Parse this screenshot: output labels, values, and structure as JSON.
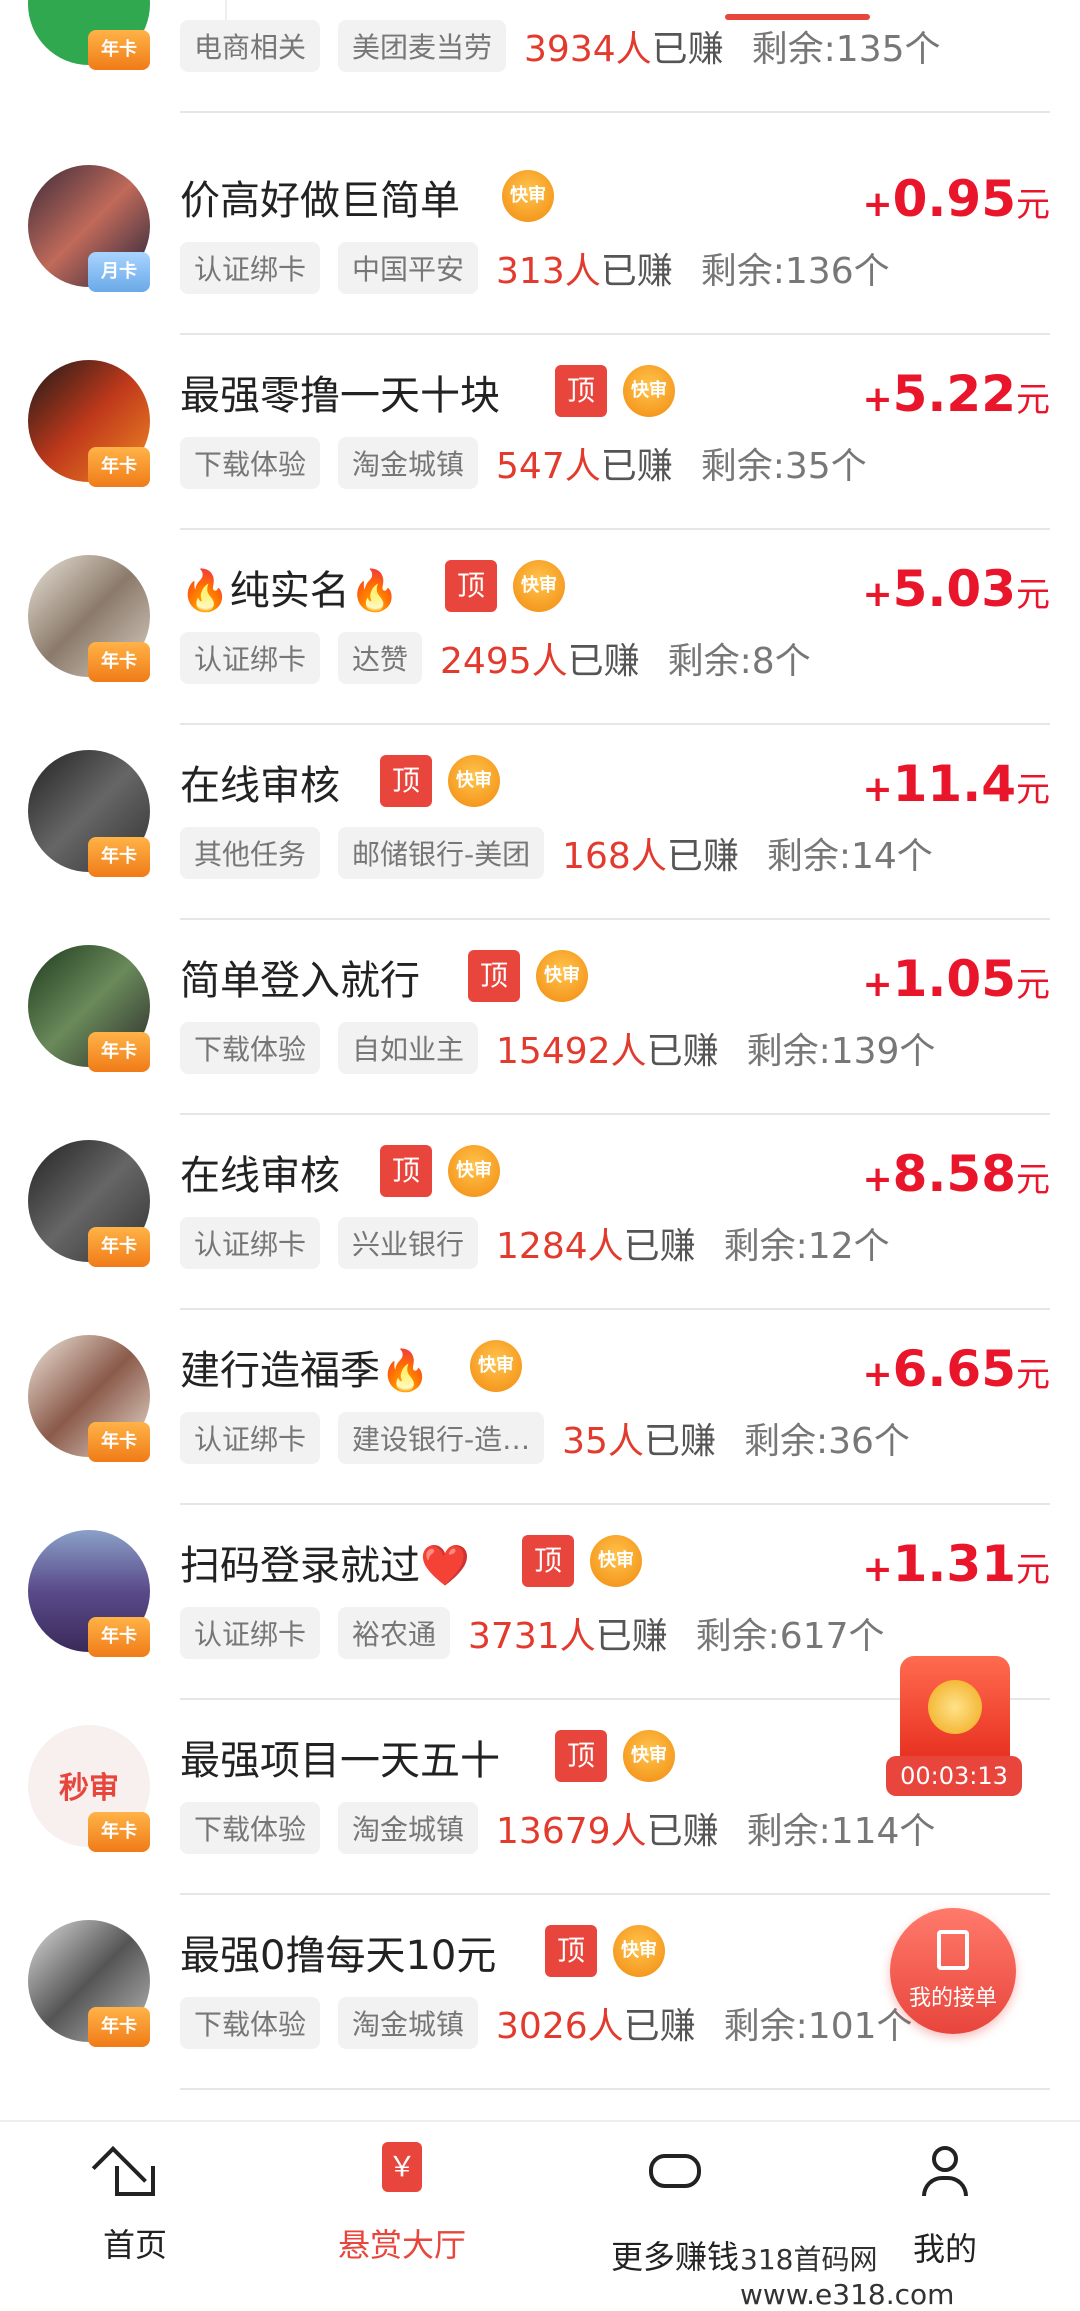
{
  "tasks": [
    {
      "title": "",
      "tag1": "电商相关",
      "tag2": "美团麦当劳",
      "earned": "3934人",
      "earned_suffix": "已赚",
      "remain": "剩余:135个",
      "reward": "",
      "badge": "年卡"
    },
    {
      "title": "价高好做巨简单",
      "tag1": "认证绑卡",
      "tag2": "中国平安",
      "earned": "313人",
      "earned_suffix": "已赚",
      "remain": "剩余:136个",
      "reward": "0.95",
      "badge": "月卡"
    },
    {
      "title": "最强零撸一天十块",
      "tag1": "下载体验",
      "tag2": "淘金城镇",
      "earned": "547人",
      "earned_suffix": "已赚",
      "remain": "剩余:35个",
      "reward": "5.22",
      "badge": "年卡"
    },
    {
      "title": "🔥纯实名🔥",
      "tag1": "认证绑卡",
      "tag2": "达赞",
      "earned": "2495人",
      "earned_suffix": "已赚",
      "remain": "剩余:8个",
      "reward": "5.03",
      "badge": "年卡"
    },
    {
      "title": "在线审核",
      "tag1": "其他任务",
      "tag2": "邮储银行-美团",
      "earned": "168人",
      "earned_suffix": "已赚",
      "remain": "剩余:14个",
      "reward": "11.4",
      "badge": "年卡"
    },
    {
      "title": "简单登入就行",
      "tag1": "下载体验",
      "tag2": "自如业主",
      "earned": "15492人",
      "earned_suffix": "已赚",
      "remain": "剩余:139个",
      "reward": "1.05",
      "badge": "年卡"
    },
    {
      "title": "在线审核",
      "tag1": "认证绑卡",
      "tag2": "兴业银行",
      "earned": "1284人",
      "earned_suffix": "已赚",
      "remain": "剩余:12个",
      "reward": "8.58",
      "badge": "年卡"
    },
    {
      "title": "建行造福季🔥",
      "tag1": "认证绑卡",
      "tag2": "建设银行-造…",
      "earned": "35人",
      "earned_suffix": "已赚",
      "remain": "剩余:36个",
      "reward": "6.65",
      "badge": "年卡"
    },
    {
      "title": "扫码登录就过❤️",
      "tag1": "认证绑卡",
      "tag2": "裕农通",
      "earned": "3731人",
      "earned_suffix": "已赚",
      "remain": "剩余:617个",
      "reward": "1.31",
      "badge": "年卡"
    },
    {
      "title": "最强项目一天五十",
      "tag1": "下载体验",
      "tag2": "淘金城镇",
      "earned": "13679人",
      "earned_suffix": "已赚",
      "remain": "剩余:114个",
      "reward": "",
      "badge": "年卡",
      "avatar_text": "秒审"
    },
    {
      "title": "最强0撸每天10元",
      "tag1": "下载体验",
      "tag2": "淘金城镇",
      "earned": "3026人",
      "earned_suffix": "已赚",
      "remain": "剩余:101个",
      "reward": "",
      "badge": "年卡"
    }
  ],
  "labels": {
    "top_flag": "顶",
    "fast_flag": "快审",
    "plus": "+",
    "unit": "元"
  },
  "floating": {
    "timer": "00:03:13",
    "my_orders": "我的接单"
  },
  "tabbar": {
    "home": "首页",
    "hall": "悬赏大厅",
    "hall_icon": "￥",
    "more": "更多赚钱",
    "mine": "我的"
  },
  "watermark": "318首码网  www.e318.com",
  "colors": {
    "accent": "#e8453c",
    "reward": "#e8152b"
  }
}
